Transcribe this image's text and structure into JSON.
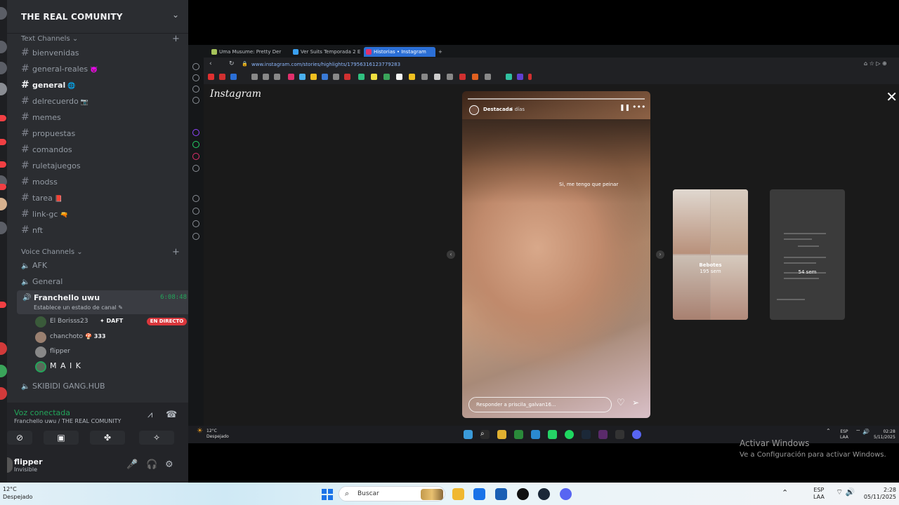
{
  "top_window_title": "...",
  "discord": {
    "server_name": "THE REAL COMUNITY",
    "text_category": "Text Channels",
    "text_channels": [
      {
        "name": "bienvenidas",
        "emoji": ""
      },
      {
        "name": "general-reales",
        "emoji": "👿"
      },
      {
        "name": "general",
        "emoji": "🌐"
      },
      {
        "name": "delrecuerdo",
        "emoji": "📷"
      },
      {
        "name": "memes",
        "emoji": ""
      },
      {
        "name": "propuestas",
        "emoji": ""
      },
      {
        "name": "comandos",
        "emoji": ""
      },
      {
        "name": "ruletajuegos",
        "emoji": ""
      },
      {
        "name": "modss",
        "emoji": ""
      },
      {
        "name": "tarea",
        "emoji": "📕"
      },
      {
        "name": "link-gc",
        "emoji": "🔫"
      },
      {
        "name": "nft",
        "emoji": ""
      }
    ],
    "voice_category": "Voice Channels",
    "voice_channels": [
      "AFK",
      "General"
    ],
    "active_voice": {
      "name": "Franchello uwu",
      "time": "6:08:48",
      "status": "Establece un estado de canal"
    },
    "members": [
      {
        "name": "El Borisss23",
        "tag": "✦ DAFT",
        "live": "EN DIRECTO"
      },
      {
        "name": "chanchoto",
        "tag": "🍄 333",
        "live": ""
      },
      {
        "name": "flipper",
        "tag": "",
        "live": ""
      },
      {
        "name": "M A I K",
        "tag": "",
        "live": ""
      }
    ],
    "other_voice": "SKIBIDI GANG.HUB",
    "voice_panel": {
      "title": "Voz conectada",
      "subtitle": "Franchello uwu / THE REAL COMUNITY"
    },
    "user": {
      "name": "flipper",
      "status": "Invisible"
    }
  },
  "browser": {
    "tabs": [
      "Uma Musume: Pretty Der",
      "Ver Suits Temporada 2 E",
      "Historias • Instagram"
    ],
    "url": "www.instagram.com/stories/highlights/17956316123779283"
  },
  "instagram": {
    "logo": "Instagram",
    "story": {
      "user": "Destacada",
      "time": "4 días",
      "caption": "Si, me tengo que peinar",
      "reply_placeholder": "Responder a priscila_galvan16..."
    },
    "next_highlight": {
      "name": "Bebotes",
      "time": "195 sem"
    },
    "next_highlight2": {
      "time": "54 sem"
    }
  },
  "inner_taskbar": {
    "weather_temp": "12°C",
    "weather_text": "Despejado",
    "lang": "ESP",
    "region": "LAA",
    "time": "02:28",
    "date": "5/11/2025"
  },
  "activate_windows": {
    "title": "Activar Windows",
    "subtitle": "Ve a Configuración para activar Windows."
  },
  "taskbar": {
    "weather_temp": "12°C",
    "weather_text": "Despejado",
    "search_placeholder": "Buscar",
    "lang": "ESP",
    "region": "LAA",
    "time": "2:28",
    "date": "05/11/2025"
  },
  "colors": {
    "discord_bg": "#2b2d31",
    "discord_green": "#23a55a",
    "live_red": "#da373c",
    "browser_active_tab": "#2b6fd6"
  }
}
